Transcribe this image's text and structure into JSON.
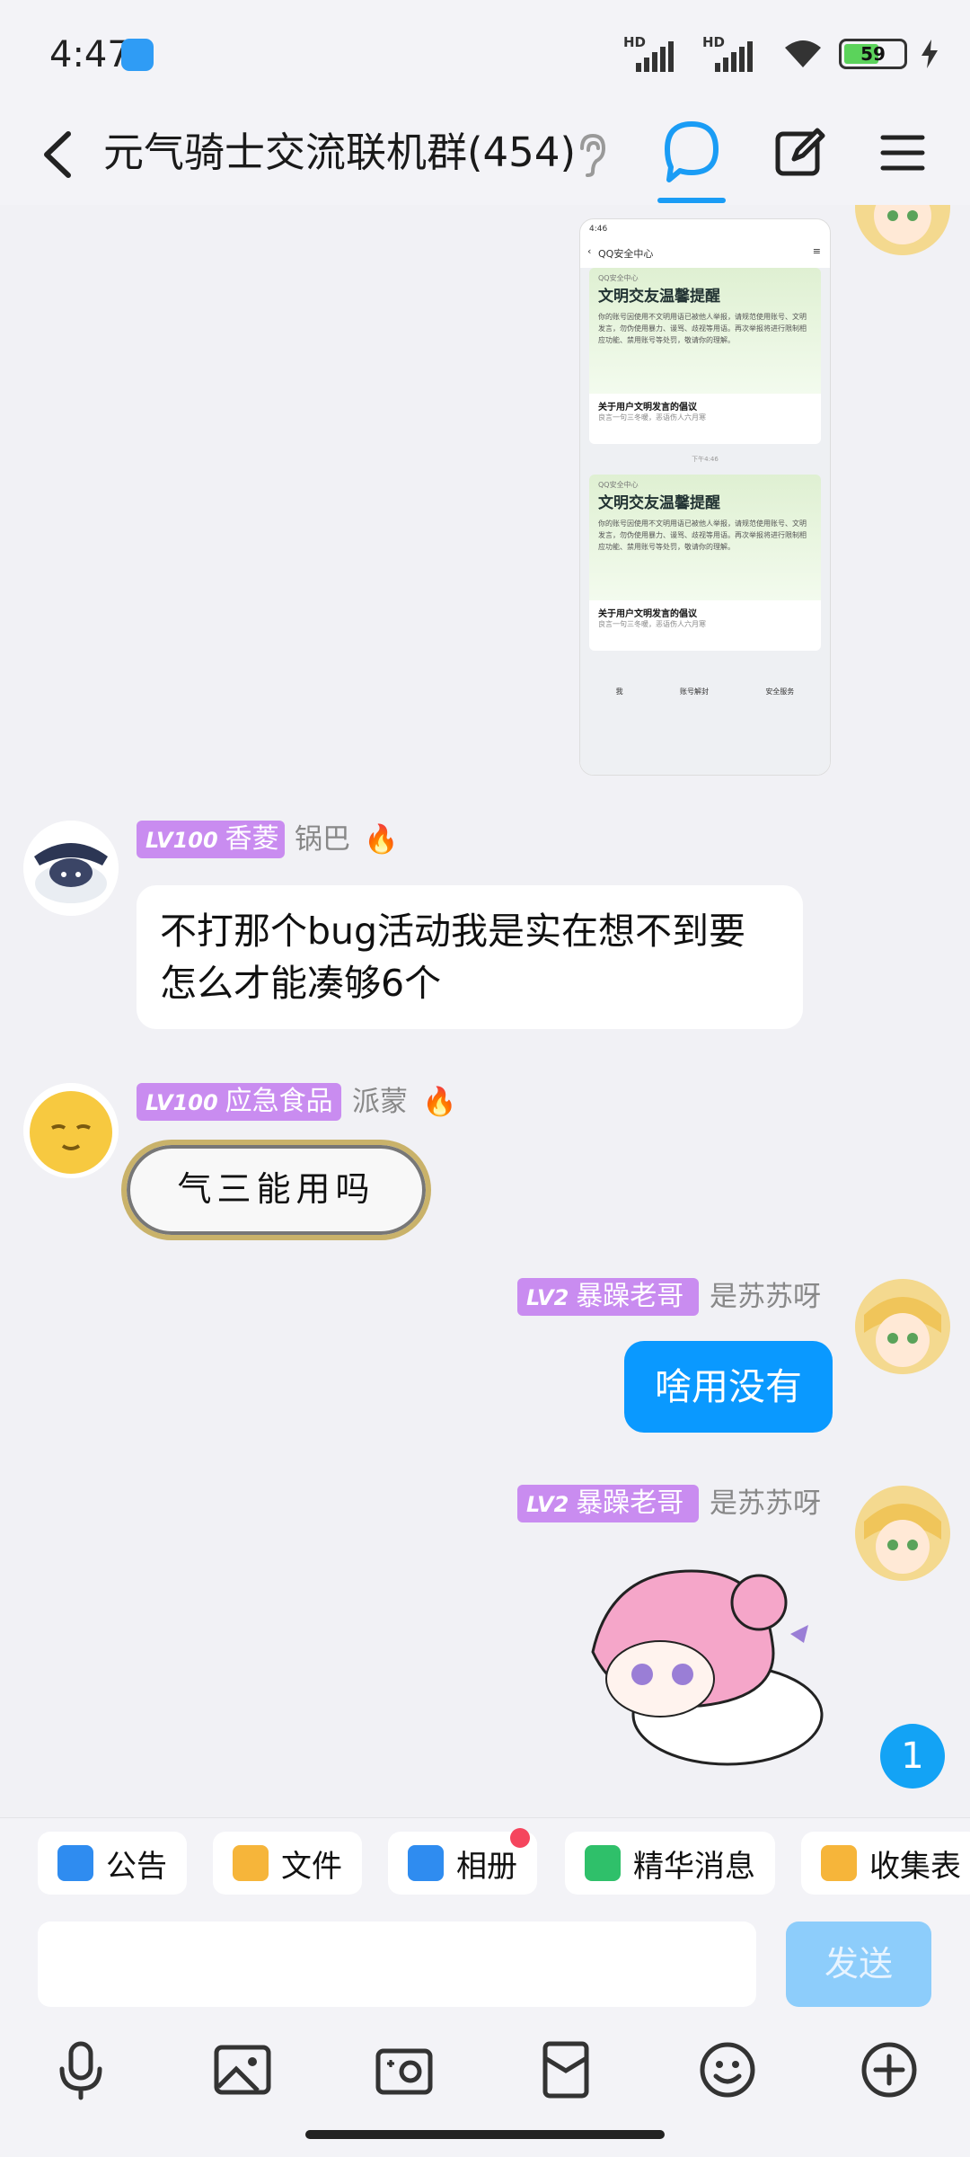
{
  "status": {
    "time": "4:47",
    "hd1": "HD",
    "hd2": "HD",
    "battery": "59"
  },
  "header": {
    "title": "元气骑士交流联机群(454)"
  },
  "screenshot": {
    "time": "4:46",
    "nav_title": "QQ安全中心",
    "cards": [
      {
        "source": "QQ安全中心",
        "heading": "文明交友温馨提醒",
        "body": "你的账号因使用不文明用语已被他人举报，请规范使用账号、文明发言，勿伪使用暴力、谩骂、歧视等用语。再次举报将进行限制相应功能、禁用账号等处罚，敬请你的理解。",
        "link_title": "关于用户文明发言的倡议",
        "link_sub": "良言一句三冬暖，恶语伤人六月寒"
      },
      {
        "source": "QQ安全中心",
        "heading": "文明交友温馨提醒",
        "body": "你的账号因使用不文明用语已被他人举报，请规范使用账号、文明发言，勿伪使用暴力、谩骂、歧视等用语。再次举报将进行限制相应功能、禁用账号等处罚，敬请你的理解。",
        "link_title": "关于用户文明发言的倡议",
        "link_sub": "良言一句三冬暖，恶语伤人六月寒"
      }
    ],
    "time_divider": "下午4:46",
    "tabs": [
      "我",
      "账号解封",
      "安全服务"
    ]
  },
  "messages": [
    {
      "level": "LV100",
      "title": "香菱",
      "nick": "锅巴",
      "text": "不打那个bug活动我是实在想不到要怎么才能凑够6个"
    },
    {
      "level": "LV100",
      "title": "应急食品",
      "nick": "派蒙",
      "text": "气三能用吗"
    },
    {
      "level": "LV2",
      "title": "暴躁老哥",
      "nick": "是苏苏呀",
      "text": "啥用没有"
    },
    {
      "level": "LV2",
      "title": "暴躁老哥",
      "nick": "是苏苏呀"
    }
  ],
  "unread_count": "1",
  "toolbar": {
    "items": [
      "公告",
      "文件",
      "相册",
      "精华消息",
      "收集表"
    ]
  },
  "input": {
    "value": "",
    "send_label": "发送"
  },
  "colors": {
    "accent": "#0a99ff",
    "tag_purple": "#c98cf0",
    "tag_orange": "#f0b65b"
  }
}
